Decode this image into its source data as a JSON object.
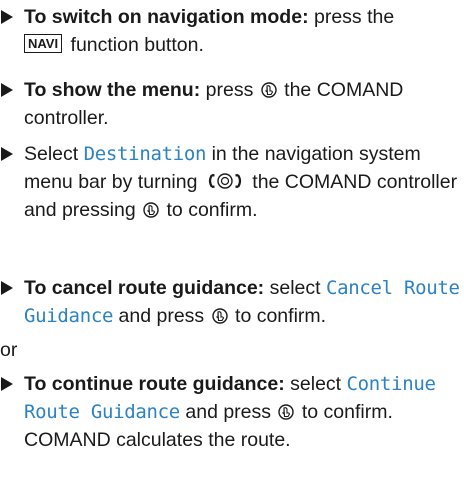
{
  "icons": {
    "press": "press-controller-icon",
    "turn": "turn-controller-icon",
    "bullet": "triangle-bullet-icon"
  },
  "steps": [
    {
      "label": "To switch on navigation mode:",
      "t1": "press the",
      "key": "NAVI",
      "t2": "function button."
    },
    {
      "label": "To show the menu:",
      "t1": "press",
      "t2": "the COMAND controller."
    },
    {
      "t0": "Select",
      "item": "Destination",
      "t1": "in the navigation system menu bar by turning",
      "t2": "the COMAND controller and pressing",
      "t3": "to confirm."
    },
    {
      "label": "To cancel route guidance:",
      "t1": "select",
      "item": "Cancel Route Guidance",
      "t2": "and press",
      "t3": "to confirm."
    },
    {
      "label": "To continue route guidance:",
      "t1": "select",
      "item": "Continue Route Guidance",
      "t2": "and press",
      "t3": "to confirm.",
      "result": "COMAND calculates the route."
    }
  ],
  "or_label": "or"
}
